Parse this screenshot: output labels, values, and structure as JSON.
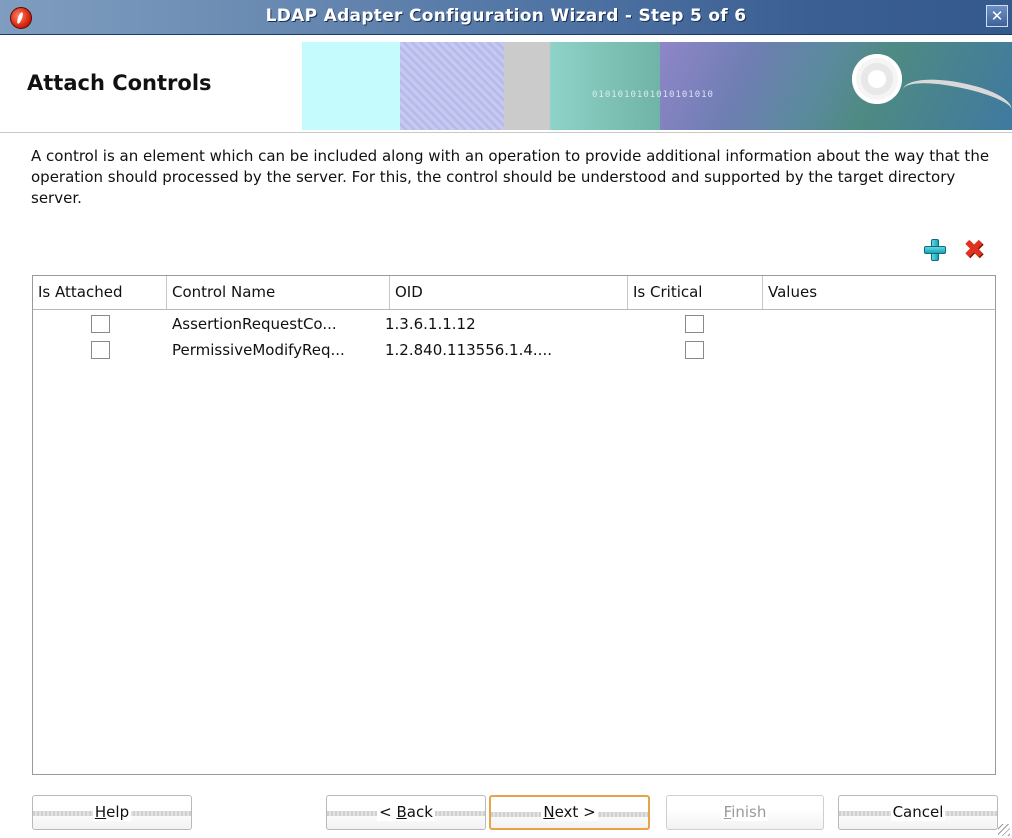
{
  "window": {
    "title": "LDAP Adapter Configuration Wizard - Step 5 of 6",
    "close_glyph": "✕"
  },
  "header": {
    "title": "Attach Controls",
    "banner_text": "0101010101010101010"
  },
  "description": "A control is an element which can be included along with an operation to provide additional information about the way that the operation should processed by the server. For this, the control should be understood and supported by the target directory server.",
  "toolbar": {
    "add_icon": "plus-icon",
    "delete_icon": "delete-x-icon",
    "delete_glyph": "✖"
  },
  "table": {
    "columns": [
      "Is Attached",
      "Control Name",
      "OID",
      "Is Critical",
      "Values"
    ],
    "rows": [
      {
        "is_attached": false,
        "control_name": "AssertionRequestCo...",
        "oid": "1.3.6.1.1.12",
        "is_critical": false,
        "values": ""
      },
      {
        "is_attached": false,
        "control_name": "PermissiveModifyReq...",
        "oid": "1.2.840.113556.1.4....",
        "is_critical": false,
        "values": ""
      }
    ]
  },
  "buttons": {
    "help": {
      "pre": "",
      "mnemonic": "H",
      "post": "elp"
    },
    "back": {
      "pre": "< ",
      "mnemonic": "B",
      "post": "ack"
    },
    "next": {
      "pre": "",
      "mnemonic": "N",
      "post": "ext >"
    },
    "finish": {
      "pre": "",
      "mnemonic": "F",
      "post": "inish"
    },
    "cancel": {
      "pre": "Cancel",
      "mnemonic": "",
      "post": ""
    }
  },
  "colors": {
    "titlebar": "#4f73a3",
    "focus_border": "#e8a34a",
    "add_icon": "#1aa3b8",
    "delete_icon": "#e0301e"
  }
}
